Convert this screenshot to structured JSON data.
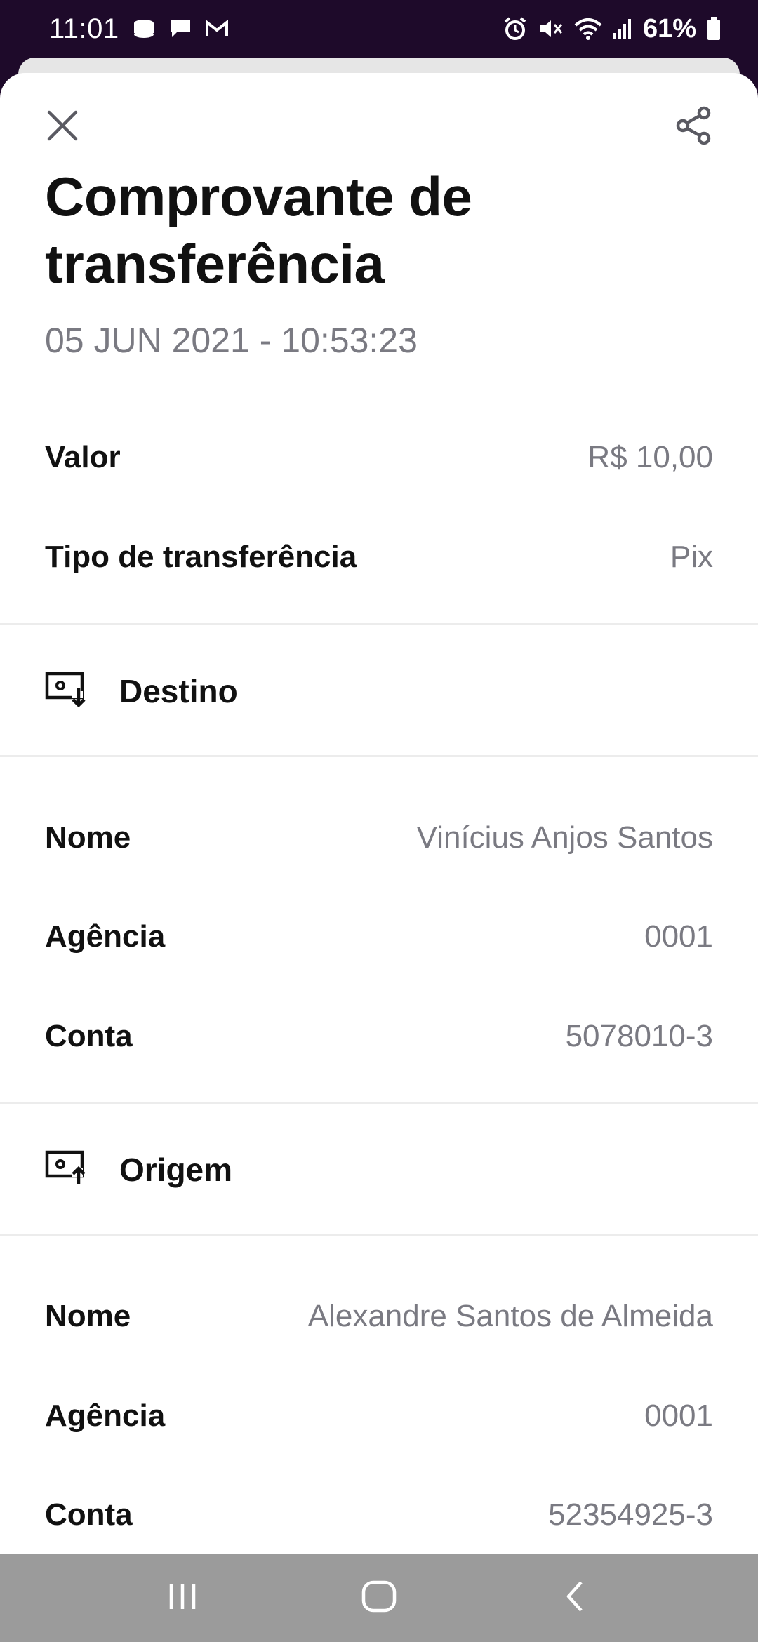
{
  "status_bar": {
    "time": "11:01",
    "battery": "61%",
    "icons_left": [
      "storage-icon",
      "chat-icon",
      "gmail-icon"
    ],
    "icons_right": [
      "alarm-icon",
      "mute-icon",
      "wifi-icon",
      "signal-icon",
      "battery-icon"
    ]
  },
  "header": {
    "close_icon": "close-icon",
    "share_icon": "share-icon"
  },
  "receipt": {
    "title": "Comprovante de transferência",
    "datetime": "05 JUN 2021 - 10:53:23",
    "valor_label": "Valor",
    "valor_value": "R$ 10,00",
    "tipo_label": "Tipo de transferência",
    "tipo_value": "Pix"
  },
  "destino": {
    "section_title": "Destino",
    "icon": "money-receive-icon",
    "nome_label": "Nome",
    "nome_value": "Vinícius Anjos Santos",
    "agencia_label": "Agência",
    "agencia_value": "0001",
    "conta_label": "Conta",
    "conta_value": "5078010-3"
  },
  "origem": {
    "section_title": "Origem",
    "icon": "money-send-icon",
    "nome_label": "Nome",
    "nome_value": "Alexandre Santos de Almeida",
    "agencia_label": "Agência",
    "agencia_value": "0001",
    "conta_label": "Conta",
    "conta_value": "52354925-3"
  },
  "nav_bar": {
    "buttons": [
      "recent-apps-icon",
      "home-icon",
      "back-icon"
    ]
  },
  "colors": {
    "status_bar_bg": "#1e0a2a",
    "text_primary": "#111111",
    "text_secondary": "#7a7a82",
    "nav_bar_bg": "#9b9b9b"
  }
}
